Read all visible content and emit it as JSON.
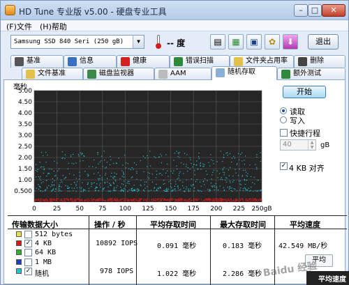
{
  "window": {
    "title": "HD Tune 专业版 v5.00 - 硬盘专业工具",
    "min_label": "–",
    "max_label": "□",
    "close_label": "✕"
  },
  "menu": [
    "(F)文件",
    "(H)帮助"
  ],
  "toolbar": {
    "drive": "Samsung SSD 840 Seri    (250 gB)",
    "temperature": "-- 度",
    "exit_label": "退出",
    "buttons": [
      {
        "icon": "copy-info-icon",
        "glyph": "▤"
      },
      {
        "icon": "copy-screenshot-icon",
        "glyph": "▦"
      },
      {
        "icon": "save-icon",
        "glyph": "▣"
      },
      {
        "icon": "options-icon",
        "glyph": "✿"
      },
      {
        "icon": "download-icon",
        "glyph": "⬇"
      }
    ]
  },
  "tabs_row1": [
    "基准",
    "信息",
    "健康",
    "错误扫描",
    "文件夹占用率",
    "删除"
  ],
  "tabs_row2": [
    "文件基准",
    "磁盘监视器",
    "AAM",
    "随机存取",
    "额外测试"
  ],
  "active_tab": "随机存取",
  "chart_unit": "毫秒",
  "controls": {
    "start_label": "开始",
    "read_label": "读取",
    "write_label": "写入",
    "short_stroke_label": "快捷行程",
    "short_stroke_value": "40",
    "short_stroke_unit": "gB",
    "align_label": "4 KB 对齐"
  },
  "table": {
    "headers": [
      "传输数据大小",
      "操作 / 秒",
      "平均存取时间",
      "最大存取时间",
      "平均速度"
    ],
    "rows": [
      {
        "color": "#e8e04a",
        "checked": false,
        "label": "512 bytes",
        "ops": "",
        "avg": "",
        "max": "",
        "speed": ""
      },
      {
        "color": "#cc1b1b",
        "checked": true,
        "label": "4 KB",
        "ops": "10892 IOPS",
        "avg": "0.091 毫秒",
        "max": "0.183 毫秒",
        "speed": "42.549 MB/秒"
      },
      {
        "color": "#2fae2f",
        "checked": false,
        "label": "64 KB",
        "ops": "",
        "avg": "",
        "max": "",
        "speed": ""
      },
      {
        "color": "#1f3fc0",
        "checked": false,
        "label": "1 MB",
        "ops": "",
        "avg": "",
        "max": "",
        "speed": ""
      },
      {
        "color": "#25c0d0",
        "checked": true,
        "label": "随机",
        "ops": "978 IOPS",
        "avg": "1.022 毫秒",
        "max": "2.286 毫秒",
        "speed": ""
      }
    ],
    "side_button": "平均",
    "status_text": "平均速度"
  },
  "chart_data": {
    "type": "scatter",
    "title": "",
    "xlabel": "",
    "ylabel": "毫秒",
    "xlim": [
      0,
      250
    ],
    "ylim": [
      0,
      5.0
    ],
    "x_ticks": [
      "0",
      "25",
      "50",
      "75",
      "100",
      "125",
      "150",
      "175",
      "200",
      "225",
      "250gB"
    ],
    "y_ticks": [
      "5.00",
      "4.50",
      "4.00",
      "3.50",
      "3.00",
      "2.50",
      "2.00",
      "1.50",
      "1.00",
      "0.500"
    ],
    "grid": true,
    "series": [
      {
        "color": "#cc1b1b",
        "y_min": 0.05,
        "y_max": 0.18,
        "x_range": [
          0,
          250
        ]
      },
      {
        "color": "#25c0d0",
        "y_min": 0.5,
        "y_max": 2.3,
        "x_range": [
          0,
          250
        ]
      }
    ]
  },
  "watermark": "Baidu 经验"
}
